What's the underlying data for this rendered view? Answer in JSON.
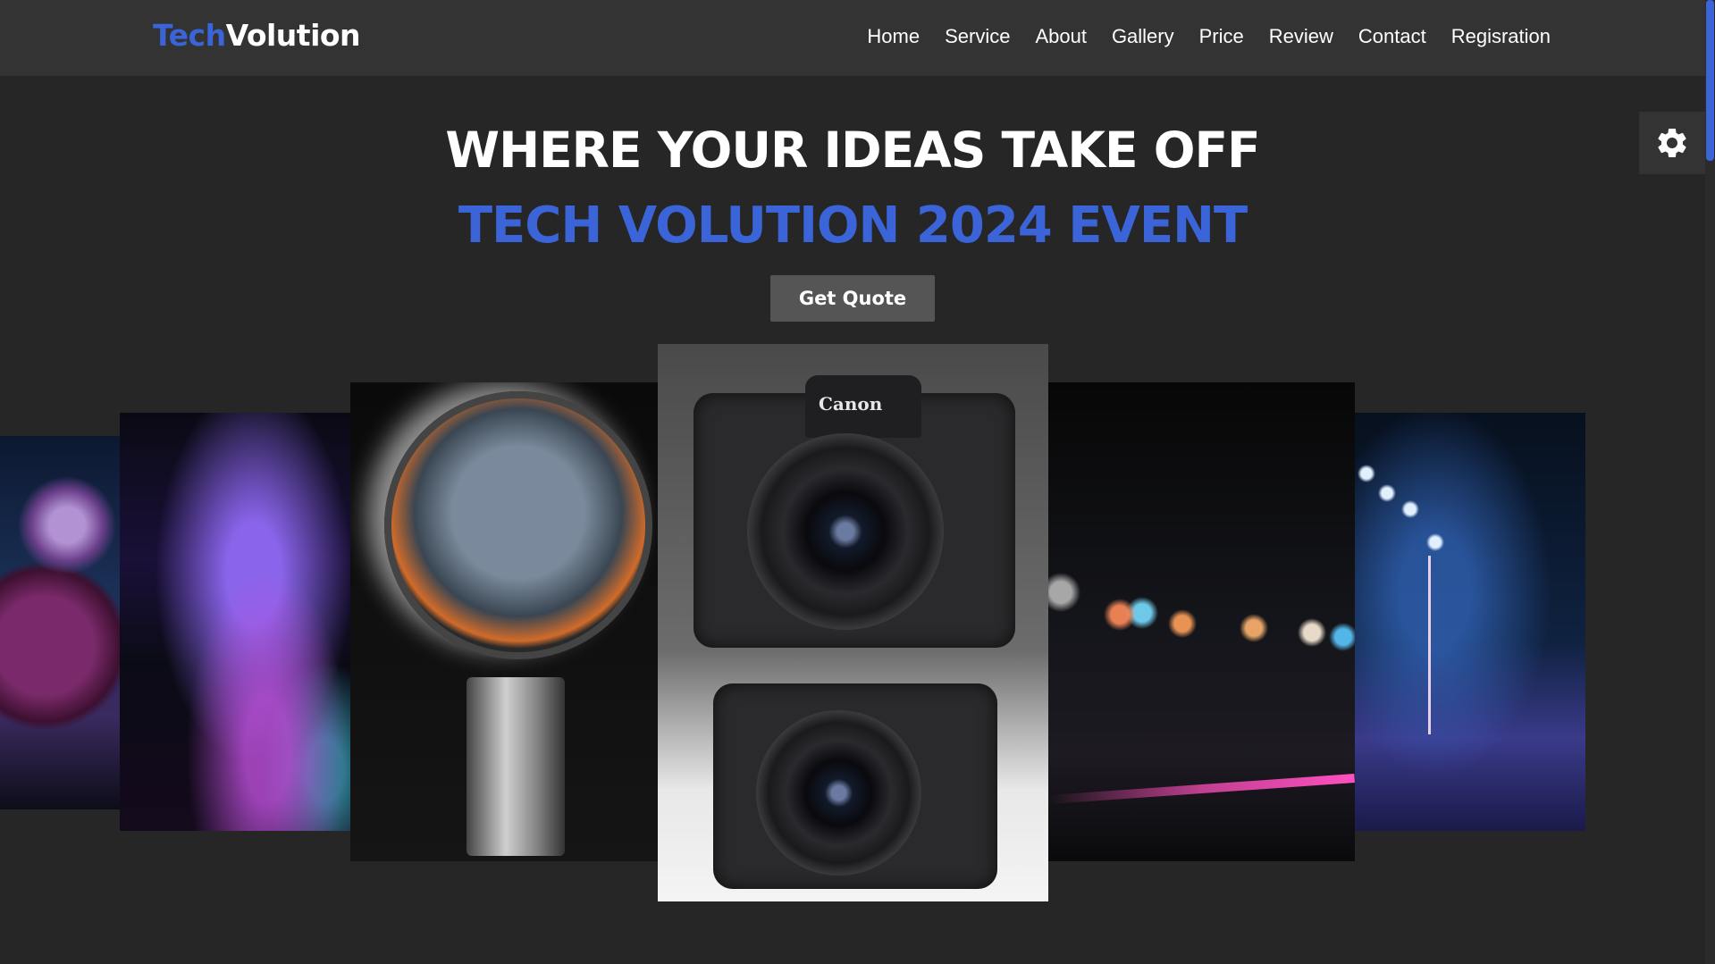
{
  "logo": {
    "part1": "Tech",
    "part2": "Volution"
  },
  "nav": {
    "items": [
      "Home",
      "Service",
      "About",
      "Gallery",
      "Price",
      "Review",
      "Contact",
      "Regisration"
    ]
  },
  "hero": {
    "title": "WHERE YOUR IDEAS TAKE OFF",
    "subtitle": "TECH VOLUTION 2024 EVENT",
    "cta_label": "Get Quote"
  },
  "slider": {
    "center_brand": "Canon",
    "slides": [
      "concert-spheres",
      "concert-stage",
      "lens-landscape",
      "canon-cameras",
      "bokeh-lights",
      "stage-lights"
    ]
  },
  "icons": {
    "settings": "gear-icon"
  },
  "colors": {
    "accent": "#3a64d8",
    "background": "#262626",
    "navbar": "#333333",
    "button": "#555555"
  }
}
